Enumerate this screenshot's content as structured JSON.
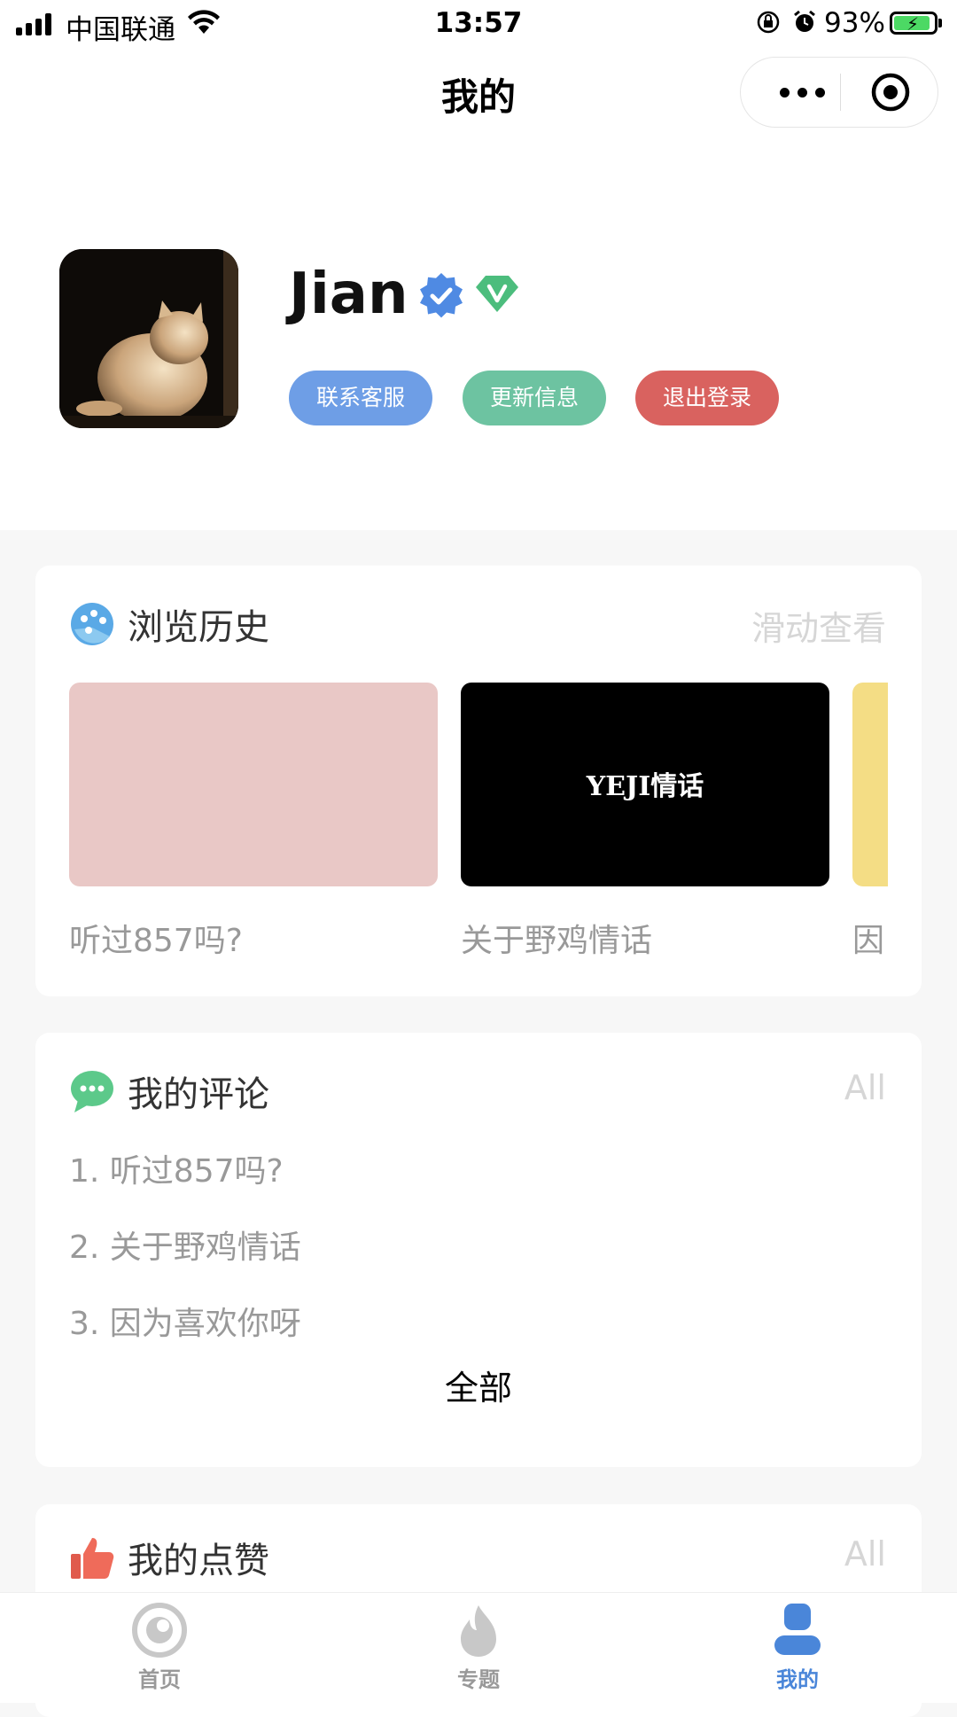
{
  "status_bar": {
    "carrier": "中国联通",
    "time": "13:57",
    "battery": "93%"
  },
  "nav": {
    "title": "我的"
  },
  "profile": {
    "name": "Jian",
    "buttons": {
      "contact": "联系客服",
      "update": "更新信息",
      "logout": "退出登录"
    }
  },
  "history": {
    "title": "浏览历史",
    "hint": "滑动查看",
    "items": [
      {
        "caption": "听过857吗?",
        "color": "#e9c8c6"
      },
      {
        "caption": "关于野鸡情话",
        "color": "#000000",
        "thumb_text": "YEJI情话"
      },
      {
        "caption": "因",
        "color": "#f4dd85"
      }
    ]
  },
  "comments": {
    "title": "我的评论",
    "more": "All",
    "items": [
      "1. 听过857吗?",
      "2. 关于野鸡情话",
      "3. 因为喜欢你呀"
    ],
    "all_label": "全部"
  },
  "likes": {
    "title": "我的点赞",
    "more": "All"
  },
  "tabbar": {
    "items": [
      {
        "label": "首页",
        "icon": "eye-icon",
        "active": false
      },
      {
        "label": "专题",
        "icon": "flame-icon",
        "active": false
      },
      {
        "label": "我的",
        "icon": "user-icon",
        "active": true
      }
    ],
    "active_color": "#4a86d9"
  }
}
